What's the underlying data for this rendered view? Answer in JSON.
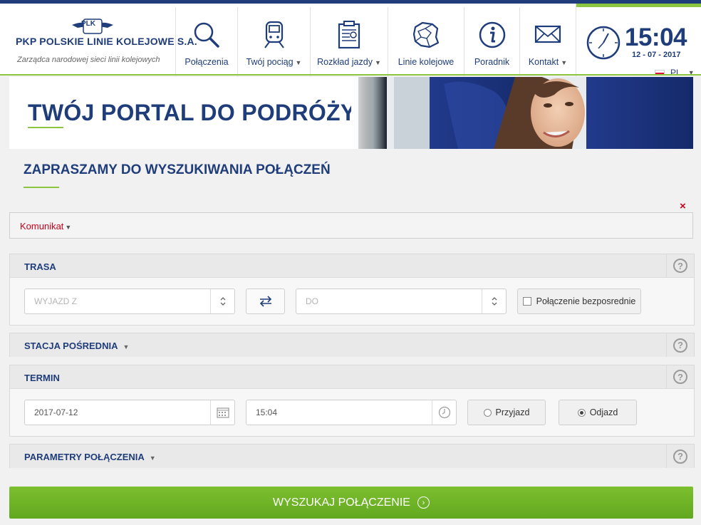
{
  "header": {
    "logo_badge": "PLK",
    "logo_title": "PKP POLSKIE LINIE KOLEJOWE S.A.",
    "logo_subtitle": "Zarządca narodowej sieci linii kolejowych",
    "nav": [
      {
        "label": "Połączenia",
        "icon": "magnifier-icon",
        "has_dropdown": false
      },
      {
        "label": "Twój pociąg",
        "icon": "train-icon",
        "has_dropdown": true
      },
      {
        "label": "Rozkład jazdy",
        "icon": "timetable-icon",
        "has_dropdown": true
      },
      {
        "label": "Linie kolejowe",
        "icon": "poland-map-icon",
        "has_dropdown": false
      },
      {
        "label": "Poradnik",
        "icon": "info-icon",
        "has_dropdown": false
      },
      {
        "label": "Kontakt",
        "icon": "envelope-icon",
        "has_dropdown": true
      }
    ],
    "clock_time": "15:04",
    "clock_date": "12 - 07 - 2017",
    "language": "PL",
    "caret": "▼"
  },
  "banner": {
    "title": "TWÓJ PORTAL DO PODRÓŻY!"
  },
  "page": {
    "heading": "ZAPRASZAMY DO WYSZUKIWANIA POŁĄCZEŃ",
    "close": "×",
    "komunikat": "Komunikat"
  },
  "trasa": {
    "title": "TRASA",
    "help": "?",
    "from_placeholder": "WYJAZD Z",
    "to_placeholder": "DO",
    "direct_label": "Połączenie bezposrednie"
  },
  "stacja": {
    "title": "STACJA POŚREDNIA",
    "help": "?"
  },
  "termin": {
    "title": "TERMIN",
    "help": "?",
    "date": "2017-07-12",
    "time": "15:04",
    "arrival_label": "Przyjazd",
    "departure_label": "Odjazd",
    "selected": "Odjazd"
  },
  "parametry": {
    "title": "PARAMETRY POŁĄCZENIA",
    "help": "?"
  },
  "search_button": "WYSZUKAJ POŁĄCZENIE",
  "colors": {
    "navy": "#1f3d7a",
    "green": "#8cc63f",
    "red": "#d0021b"
  }
}
